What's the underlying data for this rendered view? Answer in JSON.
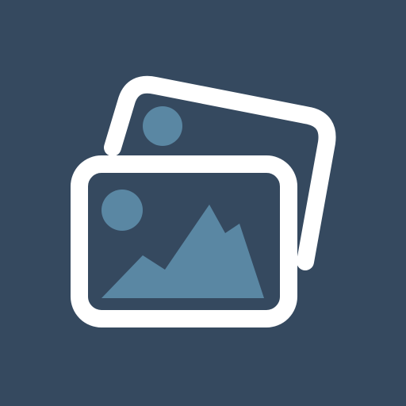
{
  "icon": {
    "name": "photo-gallery-icon",
    "colors": {
      "background": "#35495f",
      "frame": "#ffffff",
      "photo_fill": "#35495f",
      "accent": "#5a87a3"
    }
  }
}
